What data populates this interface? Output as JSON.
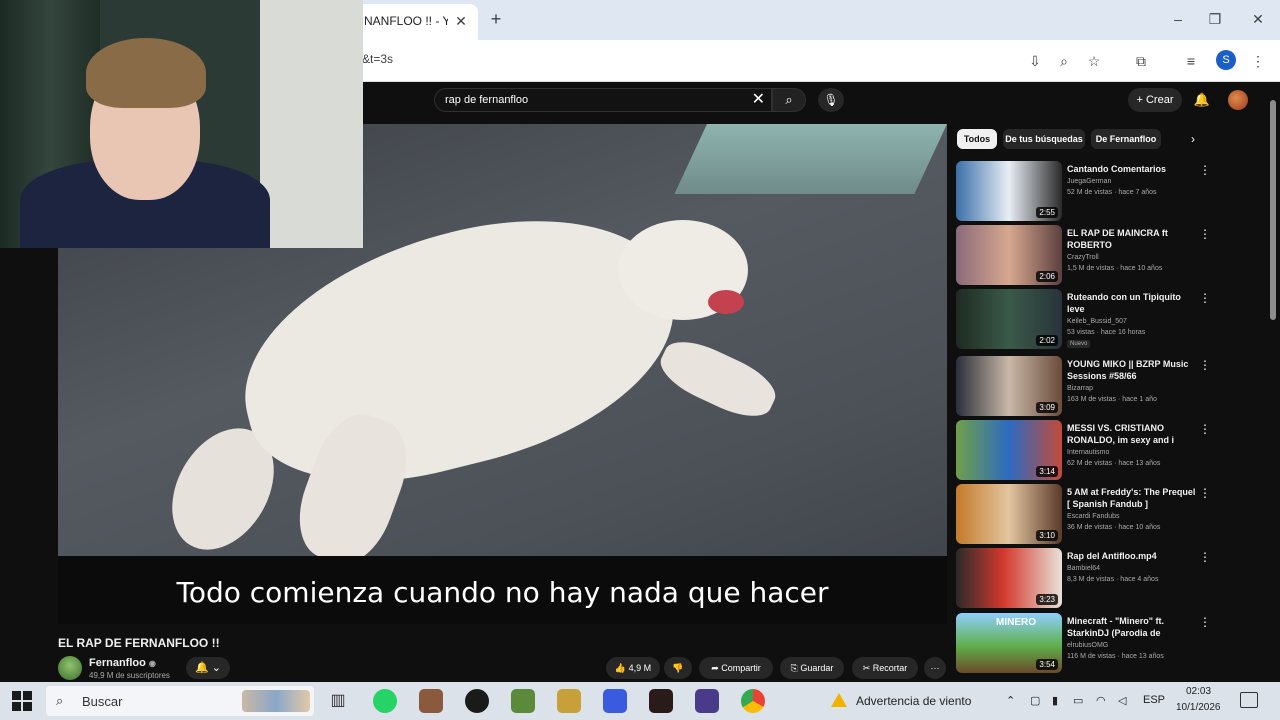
{
  "browser": {
    "tab_title": "NANFLOO !! - Yo",
    "tab_close": "✕",
    "new_tab": "+",
    "url_fragment": "&t=3s",
    "profile_initial": "S",
    "window": {
      "minimize": "–",
      "maximize": "❐",
      "close": "✕"
    }
  },
  "youtube": {
    "search": {
      "query": "rap de fernanfloo",
      "clear": "✕"
    },
    "create_label": "Crear",
    "player": {
      "subtitle": "Todo comienza cuando no hay nada que hacer"
    },
    "video": {
      "title": "EL RAP DE FERNANFLOO !!",
      "channel": "Fernanfloo",
      "verified": "◉",
      "subscribers": "49,9 M de suscriptores",
      "likes": "4,9 M",
      "share_label": "Compartir",
      "save_label": "Guardar",
      "clip_label": "Recortar",
      "more": "···"
    },
    "chips": [
      "Todos",
      "De tus búsquedas",
      "De Fernanfloo"
    ],
    "recommendations": [
      {
        "title": "Cantando Comentarios",
        "channel": "JuegaGerman",
        "meta": "52 M de vistas · hace 7 años",
        "duration": "2:55"
      },
      {
        "title": "EL RAP DE MAINCRA ft ROBERTO",
        "channel": "CrazyTroll",
        "meta": "1,5 M de vistas · hace 10 años",
        "duration": "2:06"
      },
      {
        "title": "Ruteando con un Tipiquito leve",
        "channel": "Keileb_Bussid_507",
        "meta": "53 vistas · hace 16 horas",
        "duration": "2:02",
        "badge": "Nuevo"
      },
      {
        "title": "YOUNG MIKO || BZRP Music Sessions #58/66",
        "channel": "Bizarrap",
        "meta": "163 M de vistas · hace 1 año",
        "duration": "3:09"
      },
      {
        "title": "MESSI VS. CRISTIANO RONALDO, im sexy and i know ...",
        "channel": "Internautismo",
        "meta": "62 M de vistas · hace 13 años",
        "duration": "3:14"
      },
      {
        "title": "5 AM at Freddy's: The Prequel [ Spanish Fandub ]",
        "channel": "Escardi Fandubs",
        "meta": "36 M de vistas · hace 10 años",
        "duration": "3:10"
      },
      {
        "title": "Rap del Antifloo.mp4",
        "channel": "Bambiel64",
        "meta": "8,3 M de vistas · hace 4 años",
        "duration": "3:23"
      },
      {
        "title": "Minecraft - \"Minero\" ft. StarkinDJ (Parodia de \"Torero\"...",
        "channel": "elrubiusOMG",
        "meta": "116 M de vistas · hace 13 años",
        "duration": "3:54",
        "thumb_text": "MINERO"
      }
    ]
  },
  "taskbar": {
    "search_placeholder": "Buscar",
    "weather": "Advertencia de viento",
    "lang": "ESP",
    "time": "02:03",
    "date": "10/1/2026"
  }
}
